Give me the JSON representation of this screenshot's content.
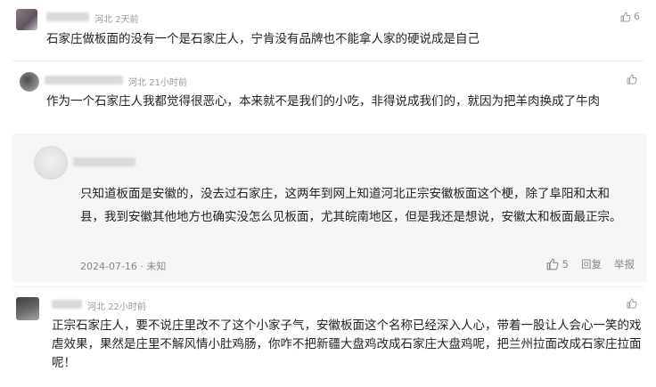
{
  "comments": [
    {
      "location": "河北",
      "time": "2天前",
      "likes": "6",
      "text": "石家庄做板面的没有一个是石家庄人，宁肯没有品牌也不能拿人家的硬说成是自己"
    },
    {
      "location": "河北",
      "time": "21小时前",
      "likes": "",
      "text": "作为一个石家庄人我都觉得很恶心，本来就不是我们的小吃，非得说成我们的，就因为把羊肉换成了牛肉"
    },
    {
      "location": "河北",
      "time": "22小时前",
      "likes": "",
      "text": "正宗石家庄人，要不说庄里改不了这个小家子气，安徽板面这个名称已经深入人心，带着一股让人会心一笑的戏虐效果，果然是庄里不解风情小肚鸡肠，你咋不把新疆大盘鸡改成石家庄大盘鸡呢，把兰州拉面改成石家庄拉面呢！"
    }
  ],
  "reply": {
    "text": "只知道板面是安徽的，没去过石家庄，这两年到网上知道河北正宗安徽板面这个梗，除了阜阳和太和县，我到安徽其他地方也确实没怎么见板面，尤其皖南地区，但是我还是想说，安徽太和板面最正宗。",
    "date": "2024-07-16 · 未知",
    "likes": "5",
    "reply_label": "回复",
    "report_label": "举报"
  },
  "icons": {
    "like": "thumbs-up-icon"
  },
  "colors": {
    "meta": "#999999",
    "reply_bg": "#f4f6f8"
  }
}
